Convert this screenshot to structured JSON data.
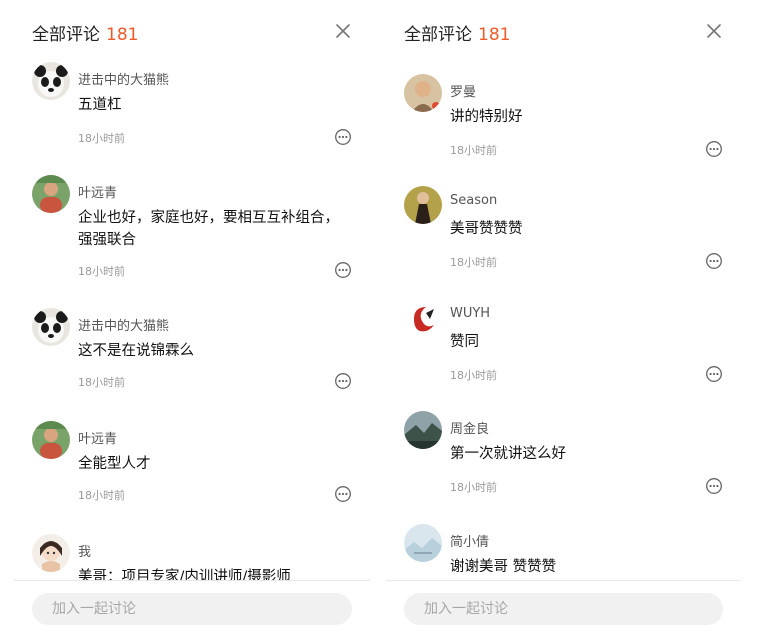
{
  "panels": [
    {
      "header": {
        "title": "全部评论",
        "count": "181"
      },
      "input_placeholder": "加入一起讨论",
      "comments": [
        {
          "name": "进击中的大猫熊",
          "text": "五道杠",
          "time": "18小时前",
          "avatar": "panda"
        },
        {
          "name": "叶远青",
          "text": "企业也好，家庭也好，要相互互补组合，强强联合",
          "time": "18小时前",
          "avatar": "person-green"
        },
        {
          "name": "进击中的大猫熊",
          "text": "这不是在说锦霖么",
          "time": "18小时前",
          "avatar": "panda"
        },
        {
          "name": "叶远青",
          "text": "全能型人才",
          "time": "18小时前",
          "avatar": "person-green"
        },
        {
          "name": "我",
          "text": "美哥：项目专家/内训讲师/摄影师",
          "time": "",
          "avatar": "doll"
        }
      ]
    },
    {
      "header": {
        "title": "全部评论",
        "count": "181"
      },
      "input_placeholder": "加入一起讨论",
      "comments": [
        {
          "name": "罗曼",
          "text": "讲的特别好",
          "time": "18小时前",
          "avatar": "portrait"
        },
        {
          "name": "Season",
          "text": "美哥赞赞赞",
          "time": "18小时前",
          "avatar": "dark-dress"
        },
        {
          "name": "WUYH",
          "text": "赞同",
          "time": "18小时前",
          "avatar": "red-logo"
        },
        {
          "name": "周金良",
          "text": "第一次就讲这么好",
          "time": "18小时前",
          "avatar": "landscape"
        },
        {
          "name": "简小倩",
          "text": "谢谢美哥 赞赞赞",
          "time": "",
          "avatar": "pale"
        }
      ]
    }
  ],
  "colors": {
    "accent": "#f05a28",
    "muted": "#9a9a9a",
    "input_bg": "#f1f1f1"
  },
  "icons": [
    "close-icon",
    "comment-reply-icon"
  ]
}
